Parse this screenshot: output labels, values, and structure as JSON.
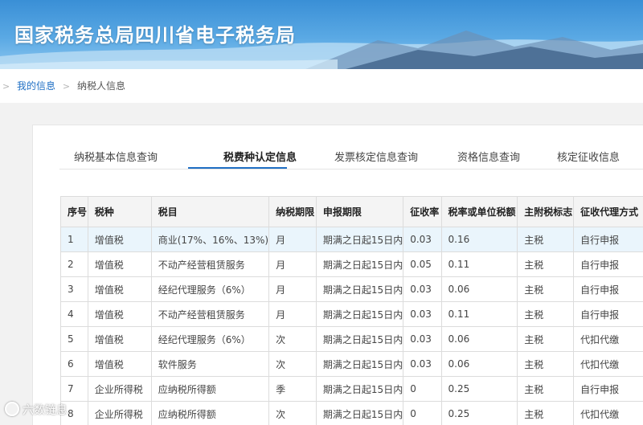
{
  "site": {
    "title": "国家税务总局四川省电子税务局"
  },
  "breadcrumb": {
    "items": [
      {
        "label": "我的信息",
        "link": true
      },
      {
        "label": "纳税人信息",
        "link": false
      }
    ]
  },
  "tabs": [
    {
      "label": "纳税基本信息查询",
      "active": false
    },
    {
      "label": "税费种认定信息",
      "active": true
    },
    {
      "label": "发票核定信息查询",
      "active": false
    },
    {
      "label": "资格信息查询",
      "active": false
    },
    {
      "label": "核定征收信息",
      "active": false
    }
  ],
  "table": {
    "columns": [
      "序号",
      "税种",
      "税目",
      "纳税期限",
      "申报期限",
      "征收率",
      "税率或单位税额",
      "主附税标志",
      "征收代理方式"
    ],
    "rows": [
      [
        "1",
        "增值税",
        "商业(17%、16%、13%)",
        "月",
        "期满之日起15日内",
        "0.03",
        "0.16",
        "主税",
        "自行申报"
      ],
      [
        "2",
        "增值税",
        "不动产经营租赁服务",
        "月",
        "期满之日起15日内",
        "0.05",
        "0.11",
        "主税",
        "自行申报"
      ],
      [
        "3",
        "增值税",
        "经纪代理服务（6%）",
        "月",
        "期满之日起15日内",
        "0.03",
        "0.06",
        "主税",
        "自行申报"
      ],
      [
        "4",
        "增值税",
        "不动产经营租赁服务",
        "月",
        "期满之日起15日内",
        "0.03",
        "0.11",
        "主税",
        "自行申报"
      ],
      [
        "5",
        "增值税",
        "经纪代理服务（6%）",
        "次",
        "期满之日起15日内",
        "0.03",
        "0.06",
        "主税",
        "代扣代缴"
      ],
      [
        "6",
        "增值税",
        "软件服务",
        "次",
        "期满之日起15日内",
        "0.03",
        "0.06",
        "主税",
        "代扣代缴"
      ],
      [
        "7",
        "企业所得税",
        "应纳税所得额",
        "季",
        "期满之日起15日内",
        "0",
        "0.25",
        "主税",
        "自行申报"
      ],
      [
        "8",
        "企业所得税",
        "应纳税所得额",
        "次",
        "期满之日起15日内",
        "0",
        "0.25",
        "主税",
        "代扣代缴"
      ]
    ],
    "selected_row": 0
  },
  "watermark": {
    "text": "六数链息"
  },
  "colors": {
    "accent": "#1f6fc4",
    "banner": "#3a8fd6",
    "selected_row": "#eaf5fc"
  }
}
